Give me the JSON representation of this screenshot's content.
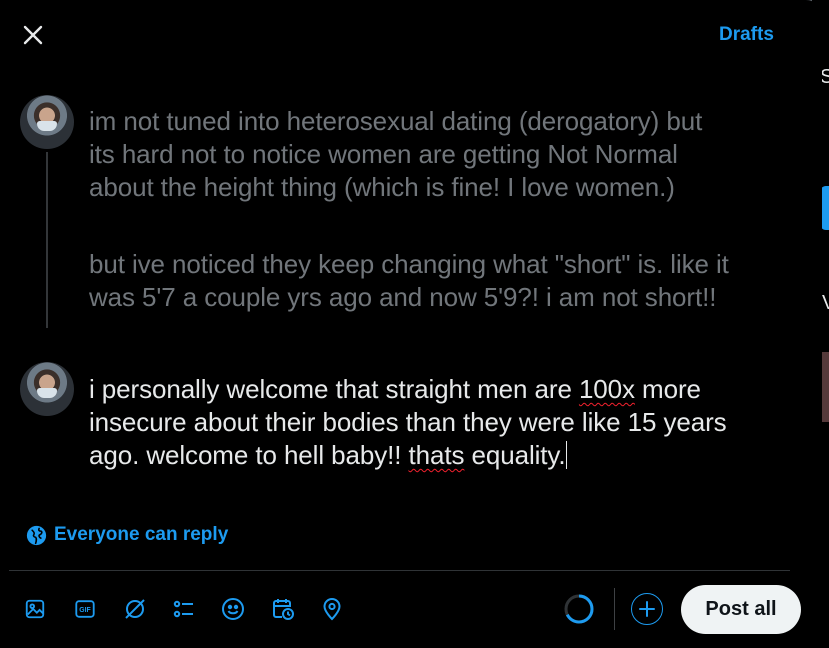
{
  "header": {
    "drafts_label": "Drafts"
  },
  "thread": {
    "previous_post": {
      "paragraphs": [
        "im not tuned into heterosexual dating (derogatory) but\nits hard not to notice women are getting Not Normal\nabout the height thing (which is fine! I love women.)",
        "but ive noticed they keep changing what \"short\" is. like it\nwas 5'7 a couple yrs ago and now 5'9?! i am not short!!"
      ]
    },
    "current_post": {
      "segments": [
        "i personally welcome that straight men are ",
        "100x",
        " more\ninsecure about their bodies than they were like 15 years\nago. welcome to hell baby!! ",
        "thats",
        " equality."
      ]
    }
  },
  "reply_setting": {
    "label": "Everyone can reply",
    "icon": "globe-icon"
  },
  "toolbar": {
    "icons": [
      "image-icon",
      "gif-icon",
      "grok-icon",
      "poll-icon",
      "emoji-icon",
      "schedule-icon",
      "location-icon"
    ],
    "add_icon": "plus-icon",
    "post_all_label": "Post all"
  },
  "colors": {
    "accent": "#1d9bf0",
    "background": "#000000",
    "text": "#e7e9ea",
    "dim_text": "#71767b",
    "spellcheck": "#f4212e"
  }
}
